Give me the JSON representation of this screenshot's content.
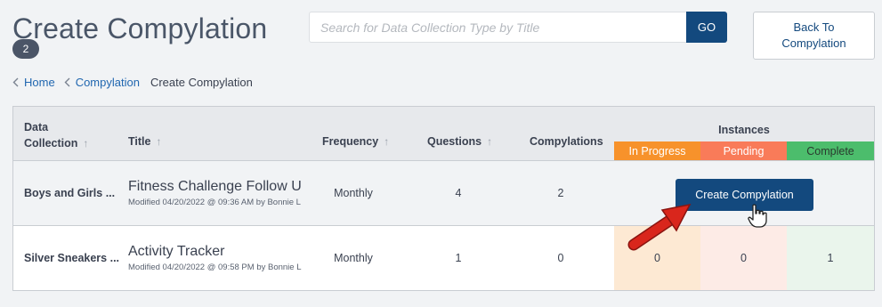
{
  "header": {
    "title": "Create Compylation",
    "badge": "2"
  },
  "search": {
    "placeholder": "Search for Data Collection Type by Title",
    "value": "",
    "go_label": "GO"
  },
  "back_button": {
    "label": "Back To Compylation"
  },
  "breadcrumb": {
    "items": [
      {
        "label": "Home"
      },
      {
        "label": "Compylation"
      },
      {
        "label": "Create Compylation"
      }
    ]
  },
  "table": {
    "columns": {
      "data_collection": "Data\nCollection",
      "title": "Title",
      "frequency": "Frequency",
      "questions": "Questions",
      "compylations": "Compylations",
      "instances": "Instances"
    },
    "instance_columns": [
      "In Progress",
      "Pending",
      "Complete"
    ],
    "rows": [
      {
        "data_collection": "Boys and Girls ...",
        "title": "Fitness Challenge Follow Up",
        "modified": "Modified 04/20/2022 @ 09:36 AM by Bonnie L",
        "frequency": "Monthly",
        "questions": "4",
        "compylations": "2",
        "action_label": "Create Compylation"
      },
      {
        "data_collection": "Silver Sneakers ...",
        "title": "Activity Tracker",
        "modified": "Modified 04/20/2022 @ 09:58 PM by Bonnie L",
        "frequency": "Monthly",
        "questions": "1",
        "compylations": "0",
        "in_progress": "0",
        "pending": "0",
        "complete": "1"
      }
    ]
  },
  "colors": {
    "primary": "#13497e",
    "link": "#2167b0",
    "in_progress": "#f7922b",
    "pending": "#f97b59",
    "complete": "#4cbd6c",
    "annotation_arrow": "#d9261c"
  },
  "icons": [
    "chevron-left-icon",
    "sort-arrow-icon",
    "red-arrow-annotation",
    "hand-cursor-icon"
  ]
}
